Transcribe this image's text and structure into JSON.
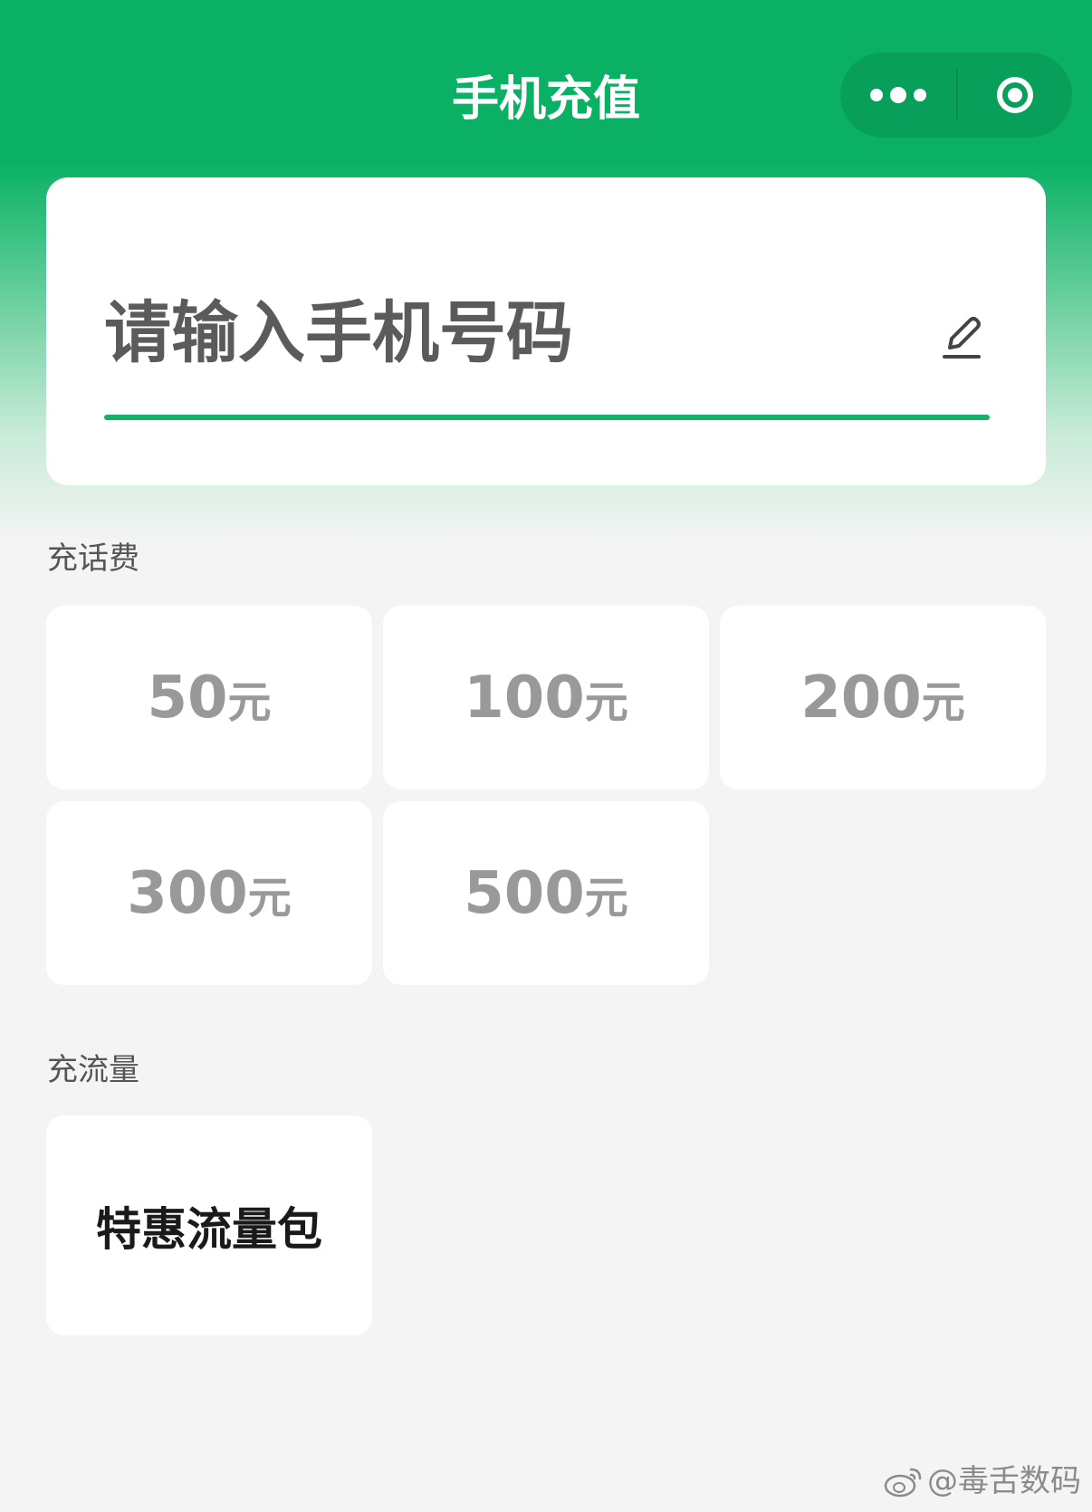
{
  "header": {
    "title": "手机充值",
    "more_icon": "more-dots-icon",
    "close_icon": "target-close-icon",
    "color": "#0ab165"
  },
  "phone": {
    "placeholder": "请输入手机号码",
    "edit_icon": "edit-pencil-icon",
    "accent": "#14b266"
  },
  "topup": {
    "label": "充话费",
    "options": [
      {
        "amount": "50",
        "unit": "元"
      },
      {
        "amount": "100",
        "unit": "元"
      },
      {
        "amount": "200",
        "unit": "元"
      },
      {
        "amount": "300",
        "unit": "元"
      },
      {
        "amount": "500",
        "unit": "元"
      }
    ]
  },
  "data_plan": {
    "label": "充流量",
    "item": "特惠流量包"
  },
  "watermark": {
    "text": "@毒舌数码",
    "icon": "weibo-icon"
  }
}
